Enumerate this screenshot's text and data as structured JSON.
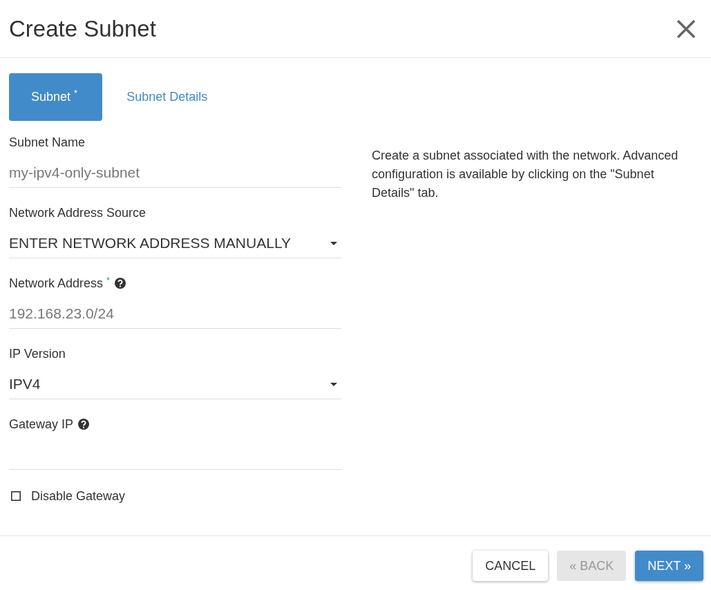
{
  "dialog": {
    "title": "Create Subnet"
  },
  "tabs": [
    {
      "label": "Subnet",
      "marker": "*",
      "selected": true
    },
    {
      "label": "Subnet Details",
      "selected": false
    }
  ],
  "fields": [
    {
      "kind": "text",
      "label": "Subnet Name",
      "placeholder": "my-ipv4-only-subnet"
    },
    {
      "kind": "select",
      "label": "Network Address Source",
      "value": "ENTER NETWORK ADDRESS MANUALLY"
    },
    {
      "kind": "text",
      "label": "Network Address",
      "required_mark": "*",
      "help": true,
      "placeholder": "192.168.23.0/24"
    },
    {
      "kind": "select",
      "label": "IP Version",
      "value": "IPV4"
    },
    {
      "kind": "text",
      "label": "Gateway IP",
      "help": true
    },
    {
      "kind": "checkbox",
      "label": "Disable Gateway",
      "checked": false
    }
  ],
  "description": "Create a subnet associated with the network. Advanced configuration is available by clicking on the \"Subnet Details\" tab.",
  "buttons": [
    {
      "kind": "cancel",
      "label": "CANCEL",
      "disabled": false
    },
    {
      "kind": "back",
      "label": "« BACK",
      "disabled": true
    },
    {
      "kind": "next",
      "label": "NEXT »",
      "disabled": false
    }
  ]
}
